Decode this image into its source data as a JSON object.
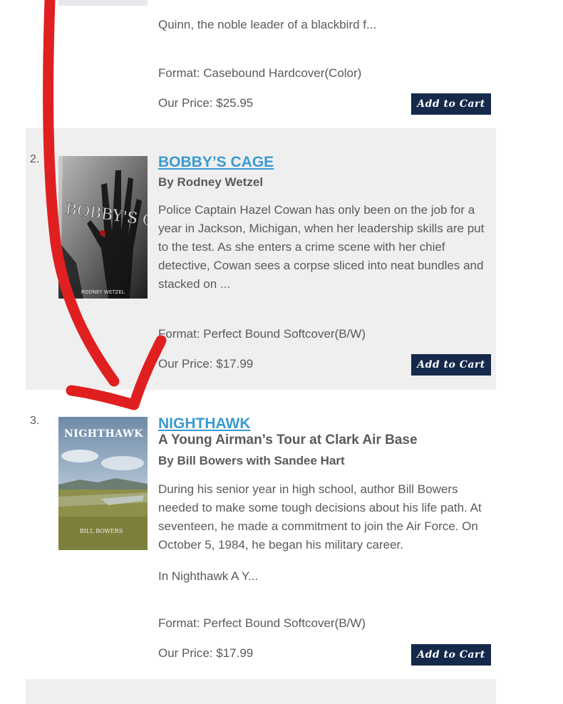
{
  "items": [
    {
      "description": "Quinn, the noble leader of a blackbird f...",
      "format": "Format: Casebound Hardcover(Color)",
      "price": "Our Price: $25.95",
      "cart_label": "Add to Cart"
    },
    {
      "number": "2.",
      "title": "BOBBY’S CAGE",
      "author": "By Rodney Wetzel",
      "cover_title": "BOBBY'S CAGE",
      "cover_author": "RODNEY WETZEL",
      "description": "Police Captain Hazel Cowan has only been on the job for a year in Jackson, Michigan, when her leadership skills are put to the test. As she enters a crime scene with her chief detective, Cowan sees a corpse sliced into neat bundles and stacked on ...",
      "format": "Format: Perfect Bound Softcover(B/W)",
      "price": "Our Price: $17.99",
      "cart_label": "Add to Cart"
    },
    {
      "number": "3.",
      "title": "NIGHTHAWK",
      "subtitle": "A Young Airman’s Tour at Clark Air Base",
      "author": "By Bill Bowers with Sandee Hart",
      "cover_title": "NIGHTHAWK",
      "cover_author": "BILL BOWERS",
      "description": "During his senior year in high school, author Bill Bowers needed to make some tough decisions about his life path. At seventeen, he made a commitment to join the Air Force. On October 5, 1984, he began his military career.",
      "description_2": "In Nighthawk A Y...",
      "format": "Format: Perfect Bound Softcover(B/W)",
      "price": "Our Price: $17.99",
      "cart_label": "Add to Cart"
    }
  ],
  "colors": {
    "link": "#3a9ad1",
    "button_bg": "#15294a",
    "shaded_bg": "#efefef",
    "annotation_arrow": "#e02020"
  },
  "annotation": {
    "icon": "red-arrow-annotation"
  }
}
